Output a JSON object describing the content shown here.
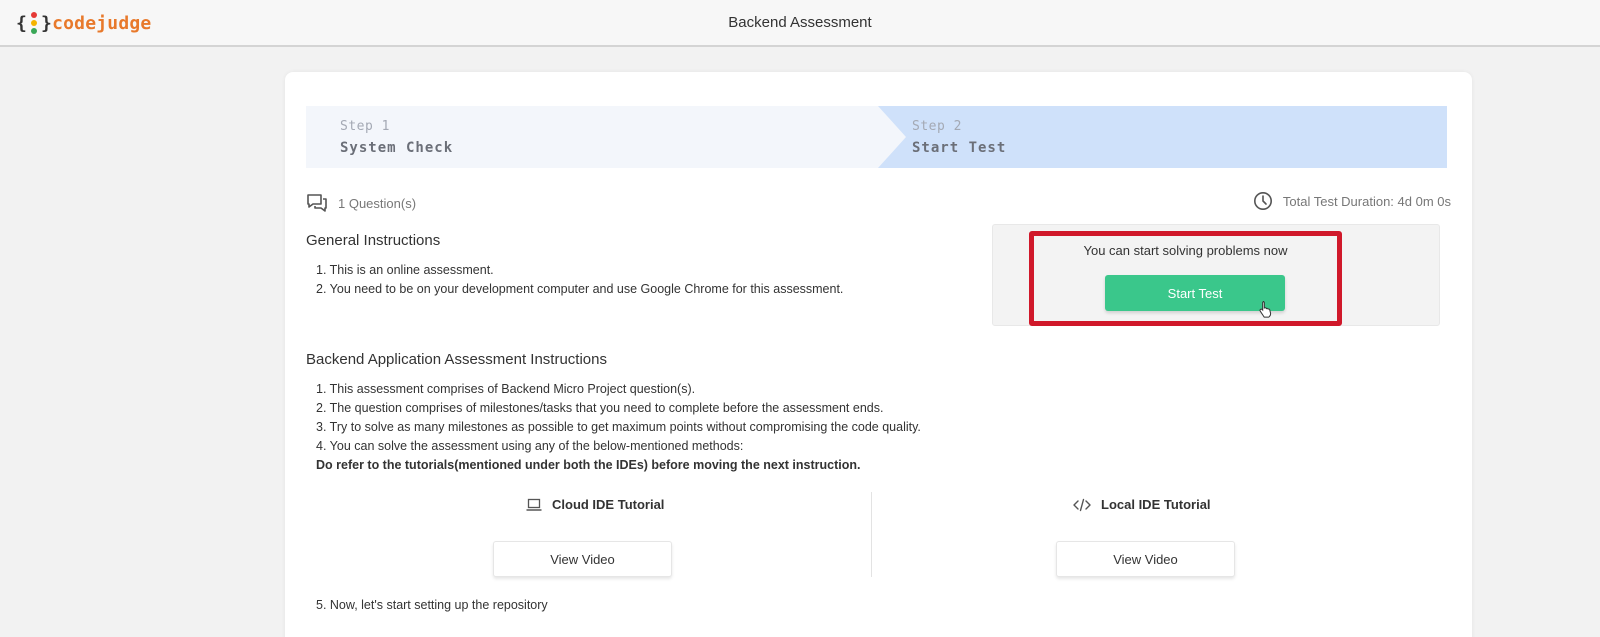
{
  "header": {
    "logo_text": "codejudge",
    "logo_brace_open": "{",
    "logo_brace_close": "}",
    "title": "Backend Assessment"
  },
  "stepper": {
    "steps": [
      {
        "number": "Step 1",
        "name": "System Check"
      },
      {
        "number": "Step 2",
        "name": "Start Test"
      }
    ]
  },
  "meta": {
    "questions": "1 Question(s)",
    "duration": "Total Test Duration: 4d 0m 0s"
  },
  "general": {
    "heading": "General Instructions",
    "items": [
      "1. This is an online assessment.",
      "2. You need to be on your development computer and use Google Chrome for this assessment."
    ]
  },
  "start_panel": {
    "message": "You can start solving problems now",
    "button": "Start Test"
  },
  "backend": {
    "heading": "Backend Application Assessment Instructions",
    "items": [
      "1. This assessment comprises of Backend Micro Project question(s).",
      "2. The question comprises of milestones/tasks that you need to complete before the assessment ends.",
      "3. Try to solve as many milestones as possible to get maximum points without compromising the code quality.",
      "4. You can solve the assessment using any of the below-mentioned methods:"
    ],
    "note": "Do refer to the tutorials(mentioned under both the IDEs) before moving the next instruction.",
    "final_item": "5. Now, let's start setting up the repository"
  },
  "tutorials": {
    "cloud": {
      "label": "Cloud IDE Tutorial",
      "button": "View Video",
      "icon": "laptop-icon"
    },
    "local": {
      "label": "Local IDE Tutorial",
      "button": "View Video",
      "icon": "code-icon"
    }
  },
  "colors": {
    "accent_green": "#3ac78b",
    "highlight_red": "#d0182a",
    "step_active": "#cfe1fa",
    "logo_orange": "#e8792b"
  }
}
